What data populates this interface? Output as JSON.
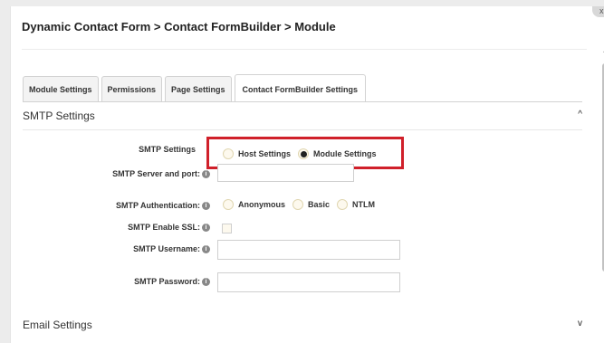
{
  "breadcrumb": "Dynamic Contact Form > Contact FormBuilder > Module",
  "close_label": "x",
  "tabs": [
    {
      "label": "Module Settings"
    },
    {
      "label": "Permissions"
    },
    {
      "label": "Page Settings"
    },
    {
      "label": "Contact FormBuilder Settings",
      "active": true
    }
  ],
  "smtp_section": {
    "title": "SMTP Settings",
    "chevron": "^",
    "smtp_settings_label": "SMTP Settings",
    "smtp_options": [
      "Host Settings",
      "Module Settings"
    ],
    "smtp_selected": "Module Settings",
    "server_label": "SMTP Server and port:",
    "server_value": "",
    "auth_label": "SMTP Authentication:",
    "auth_options": [
      "Anonymous",
      "Basic",
      "NTLM"
    ],
    "auth_selected": null,
    "ssl_label": "SMTP Enable SSL:",
    "ssl_checked": false,
    "username_label": "SMTP Username:",
    "username_value": "",
    "password_label": "SMTP Password:",
    "password_value": ""
  },
  "email_section": {
    "title": "Email Settings",
    "chevron": "v"
  },
  "icons": {
    "info": "info-icon",
    "expand": "chevron-down-icon",
    "collapse": "chevron-up-icon"
  },
  "colors": {
    "highlight": "#d0202a",
    "radio_bg": "#fdf9ee"
  }
}
